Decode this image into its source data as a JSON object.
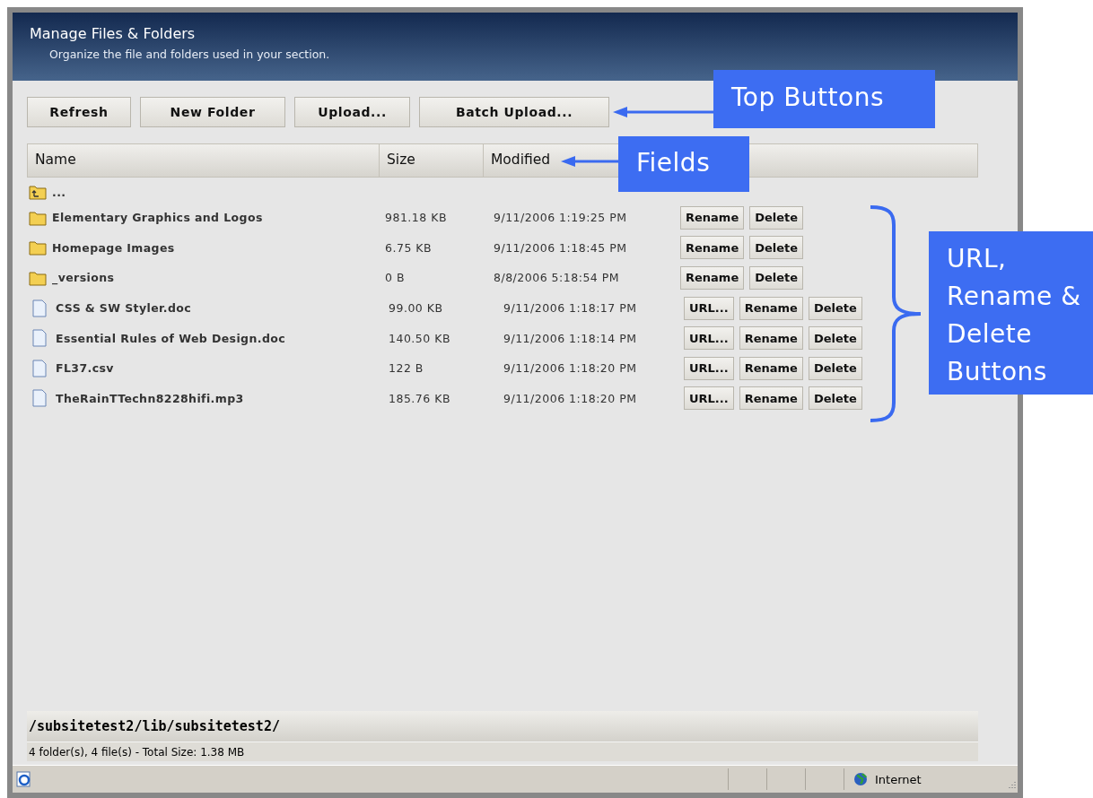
{
  "header": {
    "title": "Manage Files & Folders",
    "subtitle": "Organize the file and folders used in your section."
  },
  "toolbar": [
    "Refresh",
    "New Folder",
    "Upload...",
    "Batch Upload..."
  ],
  "table": {
    "columns": [
      "Name",
      "Size",
      "Modified"
    ],
    "rows": [
      {
        "kind": "up",
        "name": "..."
      },
      {
        "kind": "folder",
        "name": "Elementary Graphics and Logos",
        "size": "981.18 KB",
        "modified": "9/11/2006 1:19:25 PM",
        "buttons": [
          "Rename",
          "Delete"
        ]
      },
      {
        "kind": "folder",
        "name": "Homepage Images",
        "size": "6.75 KB",
        "modified": "9/11/2006 1:18:45 PM",
        "buttons": [
          "Rename",
          "Delete"
        ]
      },
      {
        "kind": "folder",
        "name": "_versions",
        "size": "0 B",
        "modified": "8/8/2006 5:18:54 PM",
        "buttons": [
          "Rename",
          "Delete"
        ]
      },
      {
        "kind": "file",
        "name": "CSS & SW Styler.doc",
        "size": "99.00 KB",
        "modified": "9/11/2006 1:18:17 PM",
        "buttons": [
          "URL...",
          "Rename",
          "Delete"
        ]
      },
      {
        "kind": "file",
        "name": "Essential Rules of Web Design.doc",
        "size": "140.50 KB",
        "modified": "9/11/2006 1:18:14 PM",
        "buttons": [
          "URL...",
          "Rename",
          "Delete"
        ]
      },
      {
        "kind": "file",
        "name": "FL37.csv",
        "size": "122 B",
        "modified": "9/11/2006 1:18:20 PM",
        "buttons": [
          "URL...",
          "Rename",
          "Delete"
        ]
      },
      {
        "kind": "file",
        "name": "TheRainTTechn8228hifi.mp3",
        "size": "185.76 KB",
        "modified": "9/11/2006 1:18:20 PM",
        "buttons": [
          "URL...",
          "Rename",
          "Delete"
        ]
      }
    ]
  },
  "path": "/subsitetest2/lib/subsitetest2/",
  "summary": "4 folder(s), 4 file(s) - Total Size: 1.38 MB",
  "status_bar": {
    "zone": "Internet"
  },
  "annotations": [
    {
      "kind": "top",
      "text": "Top Buttons"
    },
    {
      "kind": "fields",
      "text": "Fields"
    },
    {
      "kind": "rows",
      "text": "URL, Rename & Delete Buttons"
    }
  ]
}
